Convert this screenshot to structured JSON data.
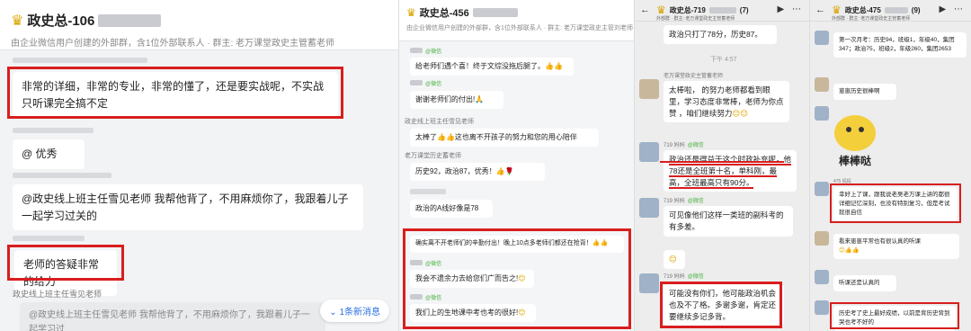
{
  "panel1": {
    "title": "政史总-106",
    "subtitle": "由企业微信用户创建的外部群，含1位外部联系人 · 群主: 老万课堂政史主管蓄老师",
    "messages": [
      "非常的详细，非常的专业，非常的懂了，还是要实战呢，不实战只听课完全搞不定",
      "@     优秀",
      "@政史线上班主任雪见老师 我帮他背了，不用麻烦你了，我跟着儿子一起学习过关的",
      "老师的答疑非常的给力"
    ],
    "sender_label": "政史线上班主任雪见老师",
    "quote": "@政史线上班主任雪见老师 我帮他背了，不用麻烦你了，我跟着儿子一起学习过",
    "new_msg": "1条新消息"
  },
  "panel2": {
    "title": "政史总-456",
    "subtitle": "由企业微信用户创建的外部群，含1位外部联系人 · 群主: 老万课堂政史主管刘老师",
    "wechat": "@微信",
    "messages": [
      "给老师们遇个喜！终于文综没拖后腿了。",
      "谢谢老师们的付出!",
      "太棒了",
      "这也离不开孩子的努力和您的用心陪伴",
      "历史92，政治87，优秀！",
      "政治的A线好像是78",
      "确实离不开老师们的辛勤付出！晚上10点多老师们都还在抢背！",
      "我会不遗余力去给您们广而告之!",
      "我们上的生地课中考也考的很好!"
    ],
    "names": [
      "政史线上班主任雪见老师",
      "老万课堂历史蓄老师"
    ]
  },
  "panel3": {
    "title": "政史总-719",
    "count": "(7)",
    "sub": "外部群 · 群主: 老万课堂政史主管蓄老师",
    "messages": [
      "政治只打了78分，历史87。",
      "太棒啦，      的努力老师都看到眼里，学习态度非常棒，老师为你点赞 ，咱们继续努力",
      "政治还是得益于这个时政补充呢，他78还是全班第十名，单科刚，最高，全班最高只有90分。",
      "可见像他们这样一类班的副科考的有多差。",
      "可能没有你们，他可能政治机会也及不了格。多谢多谢，肯定还要继续多记多背。"
    ],
    "time": "下午 4:57",
    "name_teacher": "老万课堂政史主管蓄老师",
    "name_parent": "719    妈妈"
  },
  "panel4": {
    "title": "政史总-475",
    "count": "(9)",
    "sub": "外部群 · 群主: 老万课堂政史主管蓄老师",
    "messages": [
      "第一次月考：历史94，班级1，年级40，集团347；政治75，班级2，年级260，集团2653",
      "崽崽历史很棒啊",
      "幸好上了课，跟我说老吴老万课上讲的都很详细记忆深刻，也没有特别复习，但是考试就很自信",
      "看来崽崽平常也有很认真的听课",
      "听课还是认真的",
      "历史考了史上最好成绩，以前是背历史背到哭也考不好的"
    ],
    "sticker_text": "棒棒哒",
    "name_teacher": "老万课堂政史主管蓄老师",
    "name_parent": "475    妈妈"
  }
}
